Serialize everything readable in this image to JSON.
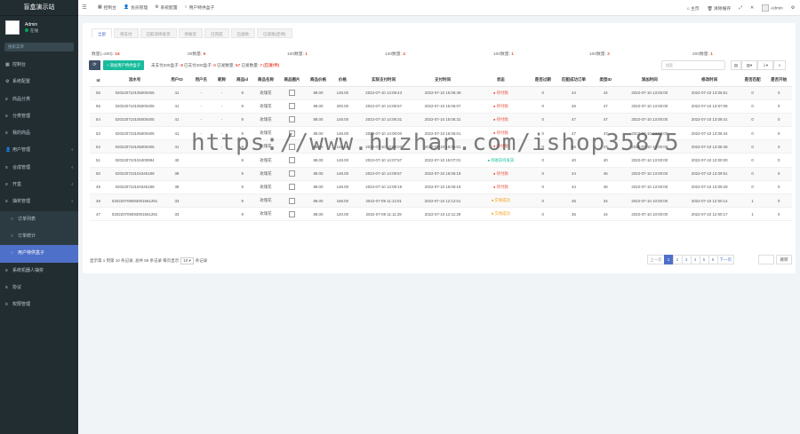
{
  "sidebar": {
    "title": "盲盒演示站",
    "user": {
      "name": "Admin",
      "status": "在线"
    },
    "search_placeholder": "搜索菜单",
    "items": [
      {
        "label": "控制台",
        "icon": "dashboard-icon"
      },
      {
        "label": "系统配置",
        "icon": "gear-icon"
      },
      {
        "label": "商品分类",
        "icon": "list-icon"
      },
      {
        "label": "分类管理",
        "icon": "list-icon"
      },
      {
        "label": "我的商品",
        "icon": "list-icon"
      },
      {
        "label": "用户管理",
        "icon": "user-icon"
      },
      {
        "label": "合成管理",
        "icon": "list-icon"
      },
      {
        "label": "开盒",
        "icon": "list-icon"
      },
      {
        "label": "抽奖管理",
        "icon": "list-icon"
      },
      {
        "label": "订单列表",
        "icon": "circle-icon",
        "sub": true
      },
      {
        "label": "订单统计",
        "icon": "circle-icon",
        "sub": true
      },
      {
        "label": "用户特供盒子",
        "icon": "circle-icon",
        "sub": true,
        "active": true
      },
      {
        "label": "系统机器人抽奖",
        "icon": "list-icon"
      },
      {
        "label": "协议",
        "icon": "list-icon"
      },
      {
        "label": "权限管理",
        "icon": "list-icon"
      }
    ]
  },
  "topbar": {
    "tabs": [
      {
        "label": "控制台",
        "icon": "dashboard-icon"
      },
      {
        "label": "会员管理",
        "icon": "user-icon"
      },
      {
        "label": "系统配置",
        "icon": "gear-icon"
      },
      {
        "label": "用户特供盒子",
        "icon": "circle-icon"
      }
    ],
    "right": {
      "home": "主页",
      "clear": "清除缓存",
      "user": "Admin"
    }
  },
  "filter_tabs": [
    "全部",
    "待支付",
    "已取消待发货",
    "待收货",
    "已完成",
    "已退款",
    "已退款(还待)"
  ],
  "stats": [
    {
      "label": "数量(=200):",
      "value": "16"
    },
    {
      "label": "00数量:",
      "value": "6"
    },
    {
      "label": "100数量:",
      "value": "1"
    },
    {
      "label": "140数量:",
      "value": "4"
    },
    {
      "label": "100数量:",
      "value": "1"
    },
    {
      "label": "100数量:",
      "value": "2"
    },
    {
      "label": "200数量:",
      "value": "1"
    }
  ],
  "toolbar": {
    "add_label": "+ 添加用户特供盒子",
    "info": [
      {
        "label": "未支付200盒子:",
        "value": "8"
      },
      {
        "label": "已支付200盒子:",
        "value": "0"
      },
      {
        "label": "已发数量:",
        "value": "57"
      },
      {
        "label": "已发数量:",
        "value": "7 (已发/件)"
      }
    ],
    "search_placeholder": "搜索"
  },
  "table": {
    "columns": [
      "Id",
      "流水号",
      "用户ID",
      "用户名",
      "昵称",
      "商品id",
      "商品名称",
      "商品图片",
      "商品价格",
      "价格",
      "实际支付时间",
      "支付时间",
      "状态",
      "是否过期",
      "匹配成功订单",
      "类型ID",
      "添加时间",
      "修改时间",
      "是否匹配",
      "是否开始"
    ],
    "rows": [
      [
        "56",
        "020220710105000405",
        "41",
        "-",
        "-",
        "9",
        "玫瑰花",
        "",
        "88.00",
        "148.00",
        "2022-07-10 14:09:43",
        "2022-07-10 15:06:49",
        "待付款",
        "0",
        "44",
        "44",
        "2022-07-10 13:00:00",
        "2022-07-10 13:06:51",
        "0",
        "0"
      ],
      [
        "55",
        "020220710105000405",
        "41",
        "-",
        "-",
        "9",
        "玫瑰花",
        "",
        "88.00",
        "200.00",
        "2022-07-10 14:09:57",
        "2022-07-10 15:06:07",
        "待付款",
        "0",
        "46",
        "47",
        "2022-07-10 13:00:00",
        "2022-07-10 13:07:06",
        "0",
        "0"
      ],
      [
        "54",
        "020220710105000405",
        "41",
        "-",
        "-",
        "9",
        "玫瑰花",
        "",
        "88.00",
        "148.00",
        "2022-07-10 14:09:31",
        "2022-07-10 15:06:31",
        "待付款",
        "0",
        "47",
        "47",
        "2022-07-10 13:00:00",
        "2022-07-10 13:08:41",
        "0",
        "0"
      ],
      [
        "53",
        "020220710105000405",
        "41",
        "-",
        "-",
        "9",
        "玫瑰花",
        "",
        "88.00",
        "148.00",
        "2022-07-10 14:09:00",
        "2022-07-10 15:06:01",
        "待付款",
        "0",
        "47",
        "47",
        "2022-07-10 13:00:00",
        "2022-07-10 13:06:44",
        "0",
        "0"
      ],
      [
        "52",
        "020220710105000405",
        "41",
        "-",
        "-",
        "9",
        "玫瑰花",
        "",
        "88.00",
        "148.00",
        "2022-07-10 14:09:07",
        "2022-07-10 15:06:01",
        "待付款",
        "0",
        "46",
        "47",
        "2022-07-10 13:00:00",
        "2022-07-10 13:06:46",
        "0",
        "0"
      ],
      [
        "51",
        "020220710104400894",
        "40",
        "",
        "",
        "9",
        "玫瑰花",
        "",
        "88.00",
        "148.00",
        "2022-07-10 14:07:57",
        "2022-07-10 15:07:01",
        "待收货待发货",
        "0",
        "40",
        "40",
        "2022-07-10 13:00:00",
        "2022-07-10 13:00:00",
        "0",
        "0"
      ],
      [
        "50",
        "020220710104345189",
        "39",
        "",
        "",
        "9",
        "玫瑰花",
        "",
        "88.00",
        "148.00",
        "2022-07-10 14:09:57",
        "2022-07-10 15:06:18",
        "待付款",
        "0",
        "44",
        "46",
        "2022-07-10 13:00:00",
        "2022-07-10 13:09:51",
        "0",
        "0"
      ],
      [
        "49",
        "020220710104345189",
        "39",
        "",
        "",
        "9",
        "玫瑰花",
        "",
        "88.00",
        "148.00",
        "2022-07-10 14:09:19",
        "2022-07-10 15:06:19",
        "待付款",
        "0",
        "44",
        "46",
        "2022-07-10 13:00:00",
        "2022-07-10 13:09:29",
        "0",
        "0"
      ],
      [
        "48",
        "020220709093001661291",
        "33",
        "",
        "",
        "9",
        "玫瑰花",
        "",
        "88.00",
        "168.00",
        "2022-07-09 11:12:01",
        "2022-07-10 12:12:01",
        "交易成功",
        "0",
        "35",
        "34",
        "2022-07-10 10:00:00",
        "2022-07-10 12:00:14",
        "1",
        "0"
      ],
      [
        "47",
        "020220709093001661291",
        "33",
        "",
        "",
        "9",
        "玫瑰花",
        "",
        "88.00",
        "120.00",
        "2022-07-09 11:11:29",
        "2022-07-10 12:11:29",
        "交易成功",
        "0",
        "36",
        "44",
        "2022-07-10 10:00:00",
        "2022-07-10 12:00:17",
        "1",
        "0"
      ]
    ],
    "status_colors": {
      "待付款": "#e74c3c",
      "待收货待发货": "#18bc9c",
      "交易成功": "#f39c12"
    }
  },
  "pager": {
    "info_pre": "显示第 1 到第 10 条记录, 总共 55 条记录 每页显示",
    "per_page": "10",
    "info_post": "条记录",
    "prev": "上一页",
    "pages": [
      "1",
      "2",
      "3",
      "4",
      "5",
      "6"
    ],
    "next": "下一页",
    "go": "跳转"
  },
  "watermark": "https://www.huzhan.com/ishop35875"
}
